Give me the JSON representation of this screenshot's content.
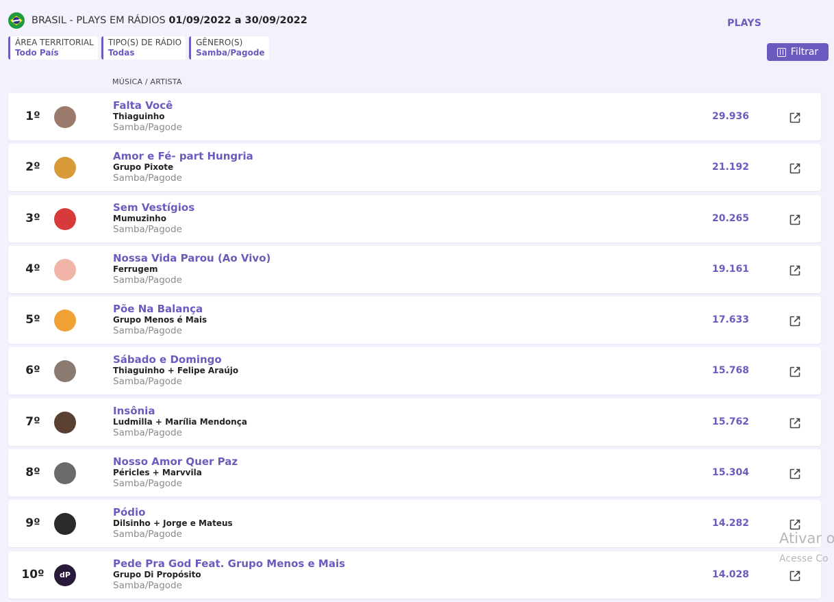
{
  "header": {
    "title": "BRASIL - PLAYS EM RÁDIOS",
    "dates": "01/09/2022 a 30/09/2022"
  },
  "filters": [
    {
      "label": "ÁREA TERRITORIAL",
      "value": "Todo País"
    },
    {
      "label": "TIPO(S) DE RÁDIO",
      "value": "Todas"
    },
    {
      "label": "GÊNERO(S)",
      "value": "Samba/Pagode"
    }
  ],
  "filter_button": {
    "label": "Filtrar",
    "icon": "sliders-icon"
  },
  "columns": {
    "music": "MÚSICA / ARTISTA",
    "plays": "PLAYS"
  },
  "colors": {
    "accent": "#6b5bbf",
    "background": "#f3f1fc"
  },
  "rows": [
    {
      "rank": "1º",
      "song": "Falta Você",
      "artist": "Thiaguinho",
      "genre": "Samba/Pagode",
      "plays": "29.936",
      "avatar_color": "#9a7a6a",
      "avatar_text": ""
    },
    {
      "rank": "2º",
      "song": "Amor e Fé- part Hungria",
      "artist": "Grupo Pixote",
      "genre": "Samba/Pagode",
      "plays": "21.192",
      "avatar_color": "#d99a3a",
      "avatar_text": ""
    },
    {
      "rank": "3º",
      "song": "Sem Vestígios",
      "artist": "Mumuzinho",
      "genre": "Samba/Pagode",
      "plays": "20.265",
      "avatar_color": "#d63a3a",
      "avatar_text": ""
    },
    {
      "rank": "4º",
      "song": "Nossa Vida Parou (Ao Vivo)",
      "artist": "Ferrugem",
      "genre": "Samba/Pagode",
      "plays": "19.161",
      "avatar_color": "#f2b3a8",
      "avatar_text": ""
    },
    {
      "rank": "5º",
      "song": "Põe Na Balança",
      "artist": "Grupo Menos é Mais",
      "genre": "Samba/Pagode",
      "plays": "17.633",
      "avatar_color": "#efa233",
      "avatar_text": ""
    },
    {
      "rank": "6º",
      "song": "Sábado e Domingo",
      "artist": "Thiaguinho + Felipe Araújo",
      "genre": "Samba/Pagode",
      "plays": "15.768",
      "avatar_color": "#8a7a70",
      "avatar_text": ""
    },
    {
      "rank": "7º",
      "song": "Insônia",
      "artist": "Ludmilla + Marília Mendonça",
      "genre": "Samba/Pagode",
      "plays": "15.762",
      "avatar_color": "#5a4030",
      "avatar_text": ""
    },
    {
      "rank": "8º",
      "song": "Nosso Amor Quer Paz",
      "artist": "Péricles + Marvvila",
      "genre": "Samba/Pagode",
      "plays": "15.304",
      "avatar_color": "#6a6a6a",
      "avatar_text": ""
    },
    {
      "rank": "9º",
      "song": "Pódio",
      "artist": "Dilsinho + Jorge e Mateus",
      "genre": "Samba/Pagode",
      "plays": "14.282",
      "avatar_color": "#2a2a2a",
      "avatar_text": ""
    },
    {
      "rank": "10º",
      "song": "Pede Pra God Feat. Grupo Menos e Mais",
      "artist": "Grupo Di Propósito",
      "genre": "Samba/Pagode",
      "plays": "14.028",
      "avatar_color": "#2a1a3a",
      "avatar_text": "dP"
    }
  ],
  "watermark": {
    "line1": "Ativar o",
    "line2": "Acesse Co"
  }
}
